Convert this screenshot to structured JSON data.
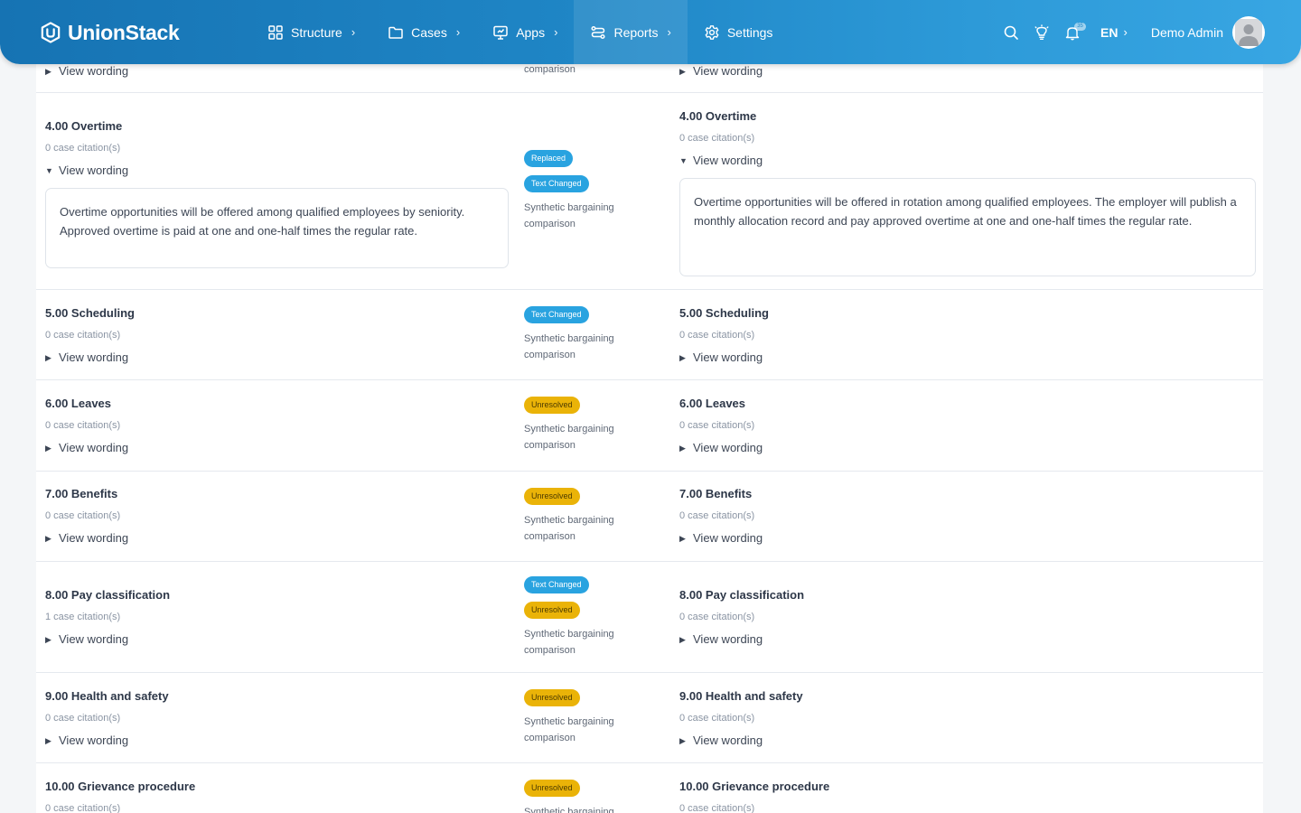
{
  "app": {
    "brand": "UnionStack"
  },
  "nav": {
    "items": [
      {
        "label": "Structure"
      },
      {
        "label": "Cases"
      },
      {
        "label": "Apps"
      },
      {
        "label": "Reports"
      },
      {
        "label": "Settings"
      }
    ],
    "chevron": "›"
  },
  "header_right": {
    "notifications_count": "35",
    "language": "EN",
    "user_name": "Demo Admin"
  },
  "common": {
    "view_wording": "View wording",
    "source_note": "Synthetic bargaining comparison",
    "comparison_word": "comparison"
  },
  "colors": {
    "brand_blue": "#1f86c6",
    "badge_blue": "#29a3e0",
    "badge_yellow": "#eab308"
  },
  "rows": [
    {
      "left": {
        "title": "4.00 Overtime",
        "citations": "0 case citation(s)",
        "wording": "Overtime opportunities will be offered among qualified employees by seniority. Approved overtime is paid at one and one-half times the regular rate."
      },
      "badges": [
        "Replaced",
        "Text Changed"
      ],
      "right": {
        "title": "4.00 Overtime",
        "citations": "0 case citation(s)",
        "wording": "Overtime opportunities will be offered in rotation among qualified employees. The employer will publish a monthly allocation record and pay approved overtime at one and one-half times the regular rate."
      }
    },
    {
      "left": {
        "title": "5.00 Scheduling",
        "citations": "0 case citation(s)"
      },
      "badges": [
        "Text Changed"
      ],
      "right": {
        "title": "5.00 Scheduling",
        "citations": "0 case citation(s)"
      }
    },
    {
      "left": {
        "title": "6.00 Leaves",
        "citations": "0 case citation(s)"
      },
      "badges": [
        "Unresolved"
      ],
      "right": {
        "title": "6.00 Leaves",
        "citations": "0 case citation(s)"
      }
    },
    {
      "left": {
        "title": "7.00 Benefits",
        "citations": "0 case citation(s)"
      },
      "badges": [
        "Unresolved"
      ],
      "right": {
        "title": "7.00 Benefits",
        "citations": "0 case citation(s)"
      }
    },
    {
      "left": {
        "title": "8.00 Pay classification",
        "citations": "1 case citation(s)"
      },
      "badges": [
        "Text Changed",
        "Unresolved"
      ],
      "right": {
        "title": "8.00 Pay classification",
        "citations": "0 case citation(s)"
      }
    },
    {
      "left": {
        "title": "9.00 Health and safety",
        "citations": "0 case citation(s)"
      },
      "badges": [
        "Unresolved"
      ],
      "right": {
        "title": "9.00 Health and safety",
        "citations": "0 case citation(s)"
      }
    },
    {
      "left": {
        "title": "10.00 Grievance procedure",
        "citations": "0 case citation(s)"
      },
      "badges": [
        "Unresolved"
      ],
      "right": {
        "title": "10.00 Grievance procedure",
        "citations": "0 case citation(s)"
      }
    }
  ]
}
